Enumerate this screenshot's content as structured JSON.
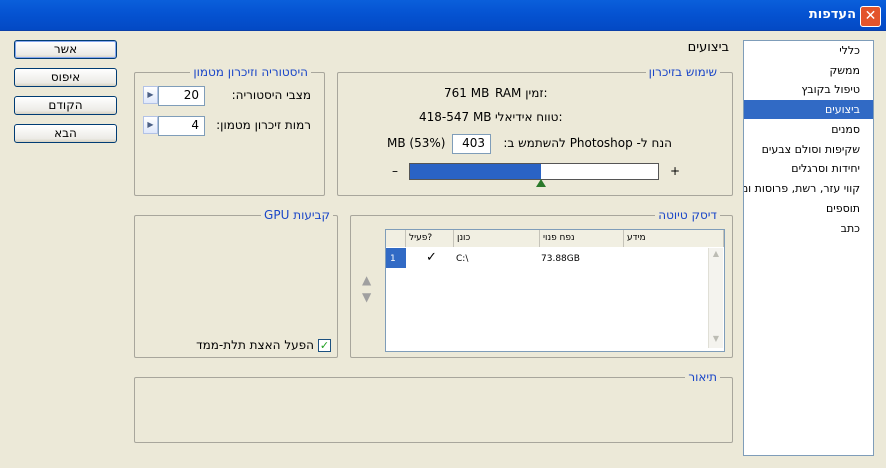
{
  "window": {
    "title": "העדפות",
    "close_glyph": "✕"
  },
  "buttons": {
    "ok": "אשר",
    "reset": "איפוס",
    "prev": "הקודם",
    "next": "הבא"
  },
  "section_title": "ביצועים",
  "sidebar": {
    "items": [
      {
        "label": "כללי",
        "selected": false
      },
      {
        "label": "ממשק",
        "selected": false
      },
      {
        "label": "טיפול בקובץ",
        "selected": false
      },
      {
        "label": "ביצועים",
        "selected": true
      },
      {
        "label": "סמנים",
        "selected": false
      },
      {
        "label": "שקיפות וסולם צבעים",
        "selected": false
      },
      {
        "label": "יחידות וסרגלים",
        "selected": false
      },
      {
        "label": "קווי עזר, רשת, פרוסות ומונה",
        "selected": false
      },
      {
        "label": "תוספים",
        "selected": false
      },
      {
        "label": "כתב",
        "selected": false
      }
    ]
  },
  "memory": {
    "legend": "שימוש בזיכרון",
    "available_label": "RAM זמין:",
    "available_value": "761 MB",
    "ideal_label": "טווח אידיאלי:",
    "ideal_value": "418-547 MB",
    "let_use_label": "הנח ל- Photoshop להשתמש ב:",
    "let_use_value": "403",
    "percent_label": "MB (53%)",
    "slider_fraction": 0.53,
    "minus": "–",
    "plus": "+"
  },
  "history": {
    "legend": "היסטוריה וזיכרון מטמון",
    "states_label": "מצבי היסטוריה:",
    "states_value": "20",
    "cache_label": "רמות זיכרון מטמון:",
    "cache_value": "4"
  },
  "scratch": {
    "legend": "דיסק טיוטה",
    "columns": {
      "active": "פעיל?",
      "drive": "כונן",
      "free": "נפח פנוי",
      "info": "מידע"
    },
    "rows": [
      {
        "index": "1",
        "active": true,
        "drive": "C:\\",
        "free": "73.88GB",
        "info": ""
      }
    ]
  },
  "gpu": {
    "legend": "קביעות GPU",
    "opengl_label": "הפעל האצת תלת-ממד",
    "opengl_checked": true
  },
  "description": {
    "legend": "תיאור"
  },
  "colors": {
    "titlebar": "#0553d2",
    "accent": "#1a46c8",
    "selection": "#316ac5",
    "slider_fill": "#2a63c5"
  }
}
